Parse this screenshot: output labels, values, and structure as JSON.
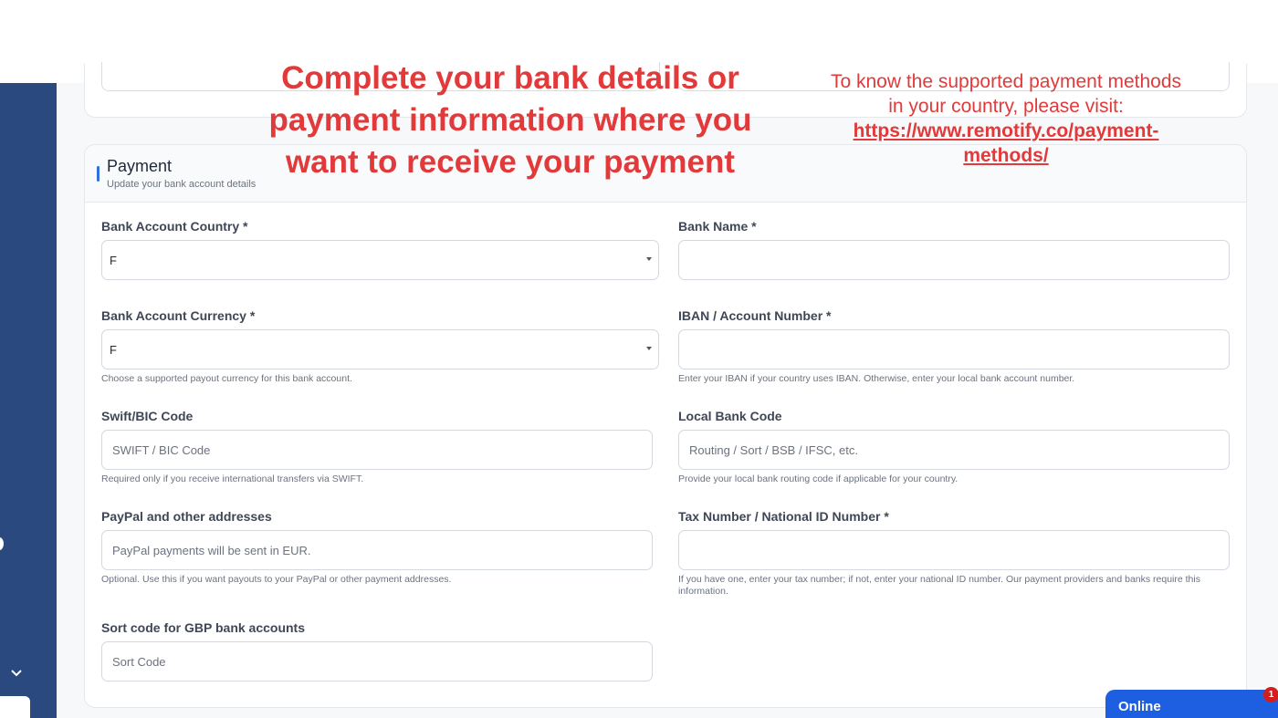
{
  "annotation": {
    "headline_line1": "Complete your bank details or",
    "headline_line2": "payment information where you",
    "headline_line3": "want to receive your payment",
    "note_line1": "To know the supported payment methods",
    "note_line2": "in your country, please visit:",
    "note_link_line1": "https://www.remotify.co/payment-",
    "note_link_line2": "methods/"
  },
  "payment": {
    "title": "Payment",
    "subtitle": "Update your bank account details",
    "bank_account_country": {
      "label": "Bank Account Country *",
      "value": "F"
    },
    "bank_name": {
      "label": "Bank Name *",
      "value": ""
    },
    "bank_account_currency": {
      "label": "Bank Account Currency *",
      "value": "F",
      "hint": "Choose a supported payout currency for this bank account."
    },
    "iban": {
      "label": "IBAN / Account Number *",
      "value": "",
      "hint": "Enter your IBAN if your country uses IBAN. Otherwise, enter your local bank account number."
    },
    "swift": {
      "label": "Swift/BIC Code",
      "placeholder": "SWIFT / BIC Code",
      "hint": "Required only if you receive international transfers via SWIFT."
    },
    "local_bank_code": {
      "label": "Local Bank Code",
      "placeholder": "Routing / Sort / BSB / IFSC, etc.",
      "hint": "Provide your local bank routing code if applicable for your country."
    },
    "paypal": {
      "label": "PayPal and other addresses",
      "placeholder": "PayPal payments will be sent in EUR.",
      "hint": "Optional. Use this if you want payouts to your PayPal or other payment addresses."
    },
    "tax_number": {
      "label": "Tax Number / National ID Number *",
      "value": "",
      "hint": "If you have one, enter your tax number; if not, enter your national ID number. Our payment providers and banks require this information."
    },
    "sort_code": {
      "label": "Sort code for GBP bank accounts",
      "placeholder": "Sort Code"
    }
  },
  "chat": {
    "label": "Online",
    "badge": "1"
  },
  "colors": {
    "sidebar": "#2a4a7f",
    "annotation_red": "#e23a3a",
    "accent_blue": "#2f6fdf",
    "chat_blue": "#1d5fe0"
  },
  "icons": {
    "sidebar_chevron": "chevron-down-icon",
    "select_caret": "caret-down-icon"
  }
}
